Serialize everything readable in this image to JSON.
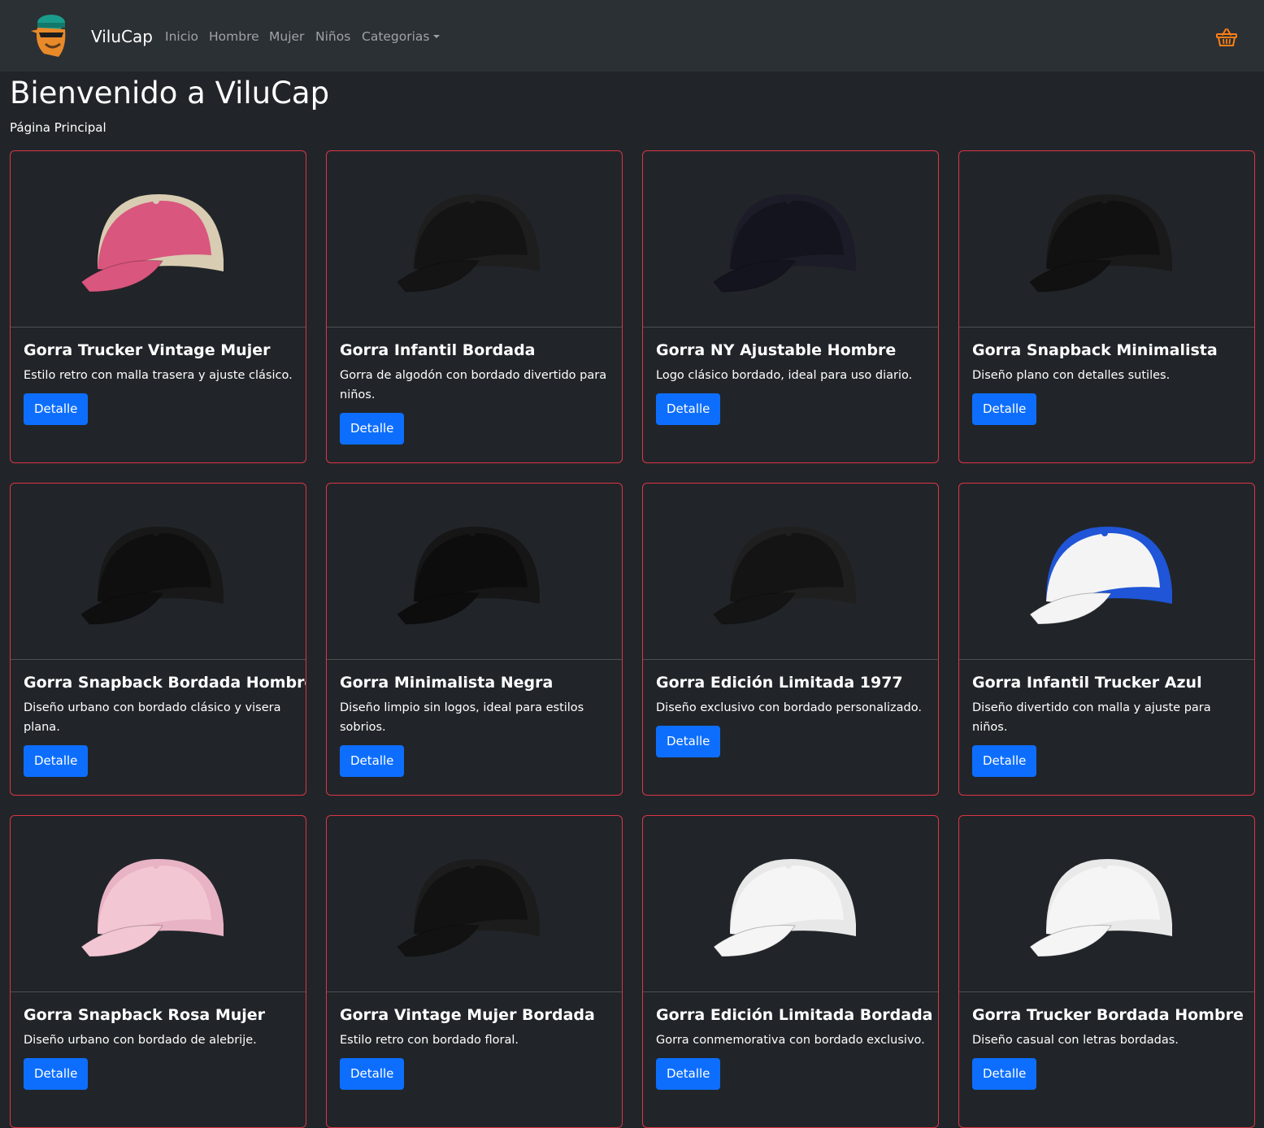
{
  "nav": {
    "brand": "ViluCap",
    "links": [
      "Inicio",
      "Hombre",
      "Mujer",
      "Niños"
    ],
    "dropdown": "Categorias",
    "cart_icon": "shopping-basket-icon",
    "cart_color": "#fd7e14"
  },
  "page": {
    "title": "Bienvenido a ViluCap",
    "subtitle": "Página Principal"
  },
  "products": [
    {
      "title": "Gorra Trucker Vintage Mujer",
      "text": "Estilo retro con malla trasera y ajuste clásico.",
      "button": "Detalle",
      "cap_color": "#d9567e",
      "back_color": "#d8ccb2"
    },
    {
      "title": "Gorra Infantil Bordada",
      "text": "Gorra de algodón con bordado divertido para niños.",
      "button": "Detalle",
      "cap_color": "#141414",
      "back_color": "#1e1e1e"
    },
    {
      "title": "Gorra NY Ajustable Hombre",
      "text": "Logo clásico bordado, ideal para uso diario.",
      "button": "Detalle",
      "cap_color": "#14141e",
      "back_color": "#1c1c28"
    },
    {
      "title": "Gorra Snapback Minimalista",
      "text": "Diseño plano con detalles sutiles.",
      "button": "Detalle",
      "cap_color": "#111111",
      "back_color": "#1a1a1a"
    },
    {
      "title": "Gorra Snapback Bordada Hombre",
      "text": "Diseño urbano con bordado clásico y visera plana.",
      "button": "Detalle",
      "cap_color": "#0f0f0f",
      "back_color": "#181818"
    },
    {
      "title": "Gorra Minimalista Negra",
      "text": "Diseño limpio sin logos, ideal para estilos sobrios.",
      "button": "Detalle",
      "cap_color": "#0d0d0d",
      "back_color": "#161616"
    },
    {
      "title": "Gorra Edición Limitada 1977",
      "text": "Diseño exclusivo con bordado personalizado.",
      "button": "Detalle",
      "cap_color": "#141414",
      "back_color": "#1f1f1f"
    },
    {
      "title": "Gorra Infantil Trucker Azul",
      "text": "Diseño divertido con malla y ajuste para niños.",
      "button": "Detalle",
      "cap_color": "#f4f4f4",
      "back_color": "#1f55d6"
    },
    {
      "title": "Gorra Snapback Rosa Mujer",
      "text": "Diseño urbano con bordado de alebrije.",
      "button": "Detalle",
      "cap_color": "#f3c6d4",
      "back_color": "#e8b3c4"
    },
    {
      "title": "Gorra Vintage Mujer Bordada",
      "text": "Estilo retro con bordado floral.",
      "button": "Detalle",
      "cap_color": "#121212",
      "back_color": "#1c1c1c"
    },
    {
      "title": "Gorra Edición Limitada Bordada",
      "text": "Gorra conmemorativa con bordado exclusivo.",
      "button": "Detalle",
      "cap_color": "#f5f5f5",
      "back_color": "#e8e8e8"
    },
    {
      "title": "Gorra Trucker Bordada Hombre",
      "text": "Diseño casual con letras bordadas.",
      "button": "Detalle",
      "cap_color": "#f5f5f5",
      "back_color": "#e9e9e9"
    }
  ]
}
